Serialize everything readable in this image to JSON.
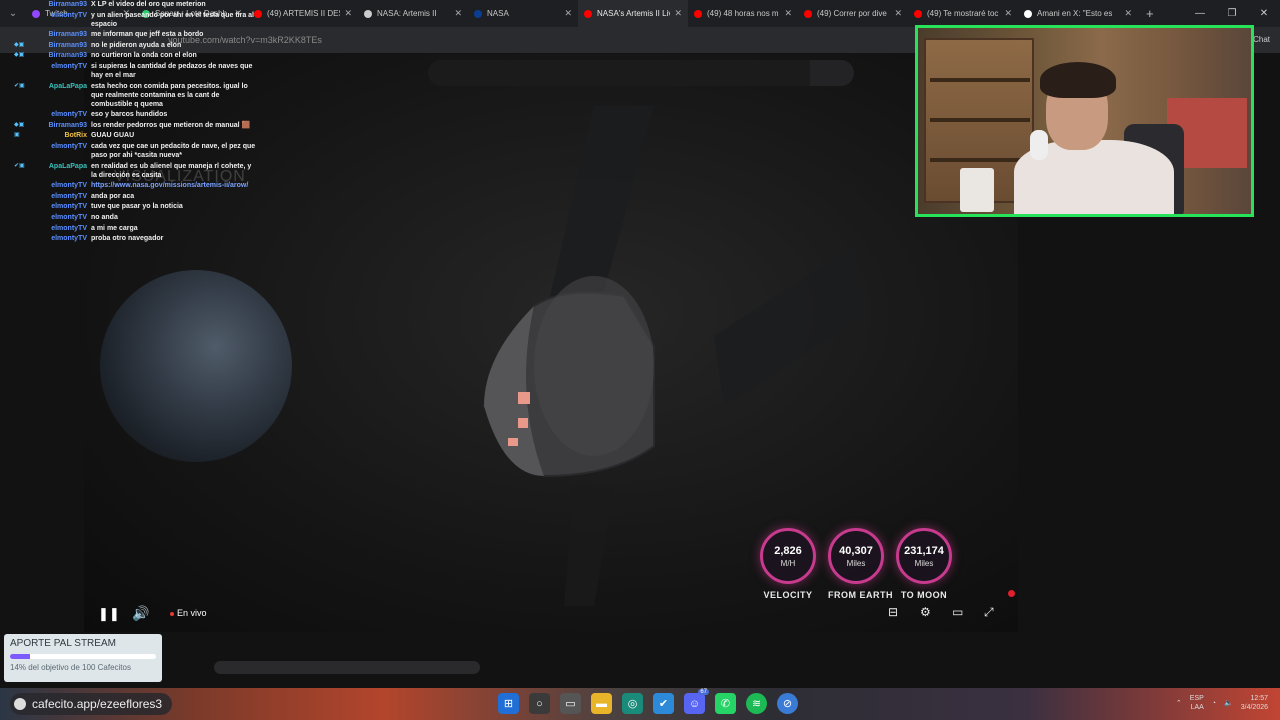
{
  "browser": {
    "tabs": [
      {
        "label": "Twitch",
        "color": "#9146ff",
        "active": false
      },
      {
        "label": "Sonarr - Lote Dashb",
        "color": "#2ecc71",
        "active": false
      },
      {
        "label": "(49) ARTEMIS II DESP",
        "color": "#ff0000",
        "active": false
      },
      {
        "label": "NASA: Artemis II",
        "color": "#cccccc",
        "active": false
      },
      {
        "label": "NASA",
        "color": "#0b3d91",
        "active": false
      },
      {
        "label": "NASA's Artemis II Liv",
        "color": "#ff0000",
        "active": true
      },
      {
        "label": "(49) 48 horas nos m",
        "color": "#ff0000",
        "active": false
      },
      {
        "label": "(49) Correr por dive",
        "color": "#ff0000",
        "active": false
      },
      {
        "label": "(49) Te mostraré toc",
        "color": "#ff0000",
        "active": false
      },
      {
        "label": "Amani en X: \"Esto es",
        "color": "#ffffff",
        "active": false
      }
    ],
    "close_glyph": "✕",
    "newtab_glyph": "+",
    "url": "youtube.com/watch?v=m3kR2KK8TEs",
    "chat_label": "Chat"
  },
  "chat": {
    "messages": [
      {
        "user": "Birraman93",
        "color": "#5a8fff",
        "badges": "",
        "text": "X LP el video del oro que meterion"
      },
      {
        "user": "elmontyTV",
        "color": "#5a8fff",
        "badges": "",
        "text": "y un alien paseando por ahí en el tesla que tira al espacio"
      },
      {
        "user": "Birraman93",
        "color": "#5a8fff",
        "badges": "",
        "text": "me informan que jeff esta a bordo"
      },
      {
        "user": "Birraman93",
        "color": "#5a8fff",
        "badges": "◆▣",
        "text": "no le pidieron ayuda a elon"
      },
      {
        "user": "Birraman93",
        "color": "#5a8fff",
        "badges": "◆▣",
        "text": "no curtieron la onda con el elon"
      },
      {
        "user": "elmontyTV",
        "color": "#5a8fff",
        "badges": "",
        "text": "si supieras la cantidad de pedazos de naves que hay en el mar"
      },
      {
        "user": "ApaLaPapa",
        "color": "#3ac0b8",
        "badges": "✔▣",
        "text": "esta hecho con comida para pecesitos. igual lo que realmente contamina es la cant de combustible q quema"
      },
      {
        "user": "elmontyTV",
        "color": "#5a8fff",
        "badges": "",
        "text": "eso y barcos hundidos"
      },
      {
        "user": "Birraman93",
        "color": "#5a8fff",
        "badges": "◆▣",
        "text": "los render pedorros que metieron de manual 🟫"
      },
      {
        "user": "BotRix",
        "color": "#f0c040",
        "badges": "▣",
        "text": "GUAU GUAU"
      },
      {
        "user": "elmontyTV",
        "color": "#5a8fff",
        "badges": "",
        "text": "cada vez que cae un pedacito de nave, el pez que paso por ahi *casita nueva*"
      },
      {
        "user": "ApaLaPapa",
        "color": "#3ac0b8",
        "badges": "✔▣",
        "text": "en realidad es ub alienel que maneja rl cohete, y la dirección es casita"
      },
      {
        "user": "elmontyTV",
        "color": "#5a8fff",
        "badges": "",
        "text": "https://www.nasa.gov/missions/artemis-ii/arow/",
        "link": true
      },
      {
        "user": "elmontyTV",
        "color": "#5a8fff",
        "badges": "",
        "text": "anda por aca"
      },
      {
        "user": "elmontyTV",
        "color": "#5a8fff",
        "badges": "",
        "text": "tuve que pasar yo la noticia"
      },
      {
        "user": "elmontyTV",
        "color": "#5a8fff",
        "badges": "",
        "text": "no anda"
      },
      {
        "user": "elmontyTV",
        "color": "#5a8fff",
        "badges": "",
        "text": "a mi me carga"
      },
      {
        "user": "elmontyTV",
        "color": "#5a8fff",
        "badges": "",
        "text": "proba otro navegador"
      }
    ]
  },
  "video": {
    "watermark": "VISUALIZATION",
    "gauges": [
      {
        "value": "2,826",
        "unit": "M/H",
        "label": "VELOCITY"
      },
      {
        "value": "40,307",
        "unit": "Miles",
        "label": "FROM EARTH"
      },
      {
        "value": "231,174",
        "unit": "Miles",
        "label": "TO MOON"
      }
    ],
    "controls": {
      "pause_icon": "❚❚",
      "volume_icon": "🔊",
      "live_label": "En vivo",
      "captions_icon": "⊟",
      "settings_icon": "⚙",
      "theater_icon": "▭",
      "fullscreen_icon": "⤢"
    }
  },
  "donation": {
    "title": "APORTE PAL STREAM",
    "progress_percent": 14,
    "subtitle": "14% del objetivo de 100 Cafecitos"
  },
  "taskbar": {
    "cafecito_link": "cafecito.app/ezeeflores3",
    "discord_badge": "67",
    "lang": "ESP",
    "lang2": "LAA",
    "time": "12:57",
    "date": "3/4/2026"
  }
}
